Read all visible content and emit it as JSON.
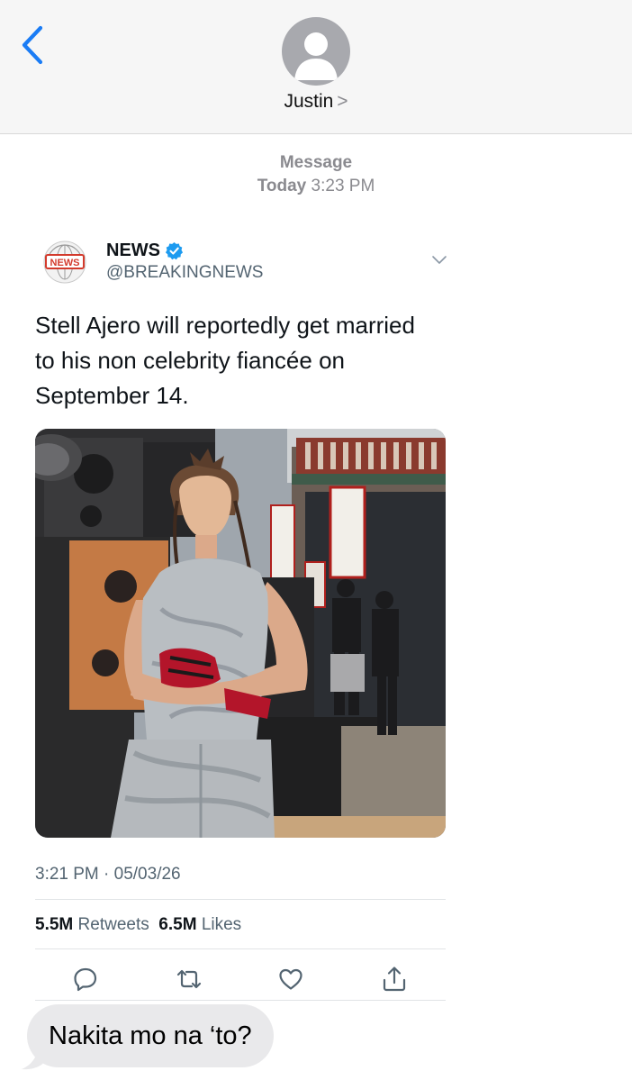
{
  "header": {
    "contact_name": "Justin",
    "contact_chevron": ">",
    "back_icon": "chevron-left-icon",
    "avatar_icon": "person-silhouette-icon",
    "accent_color": "#1a7cf5"
  },
  "conversation": {
    "service": "Message",
    "date_label": "Today",
    "time": "3:23 PM"
  },
  "tweet": {
    "logo_text": "NEWS",
    "name": "NEWS",
    "handle": "@BREAKINGNEWS",
    "verified_icon": "verified-badge-icon",
    "verified_color": "#1d9bf0",
    "text": "Stell Ajero will reportedly get married to his non celebrity fiancée on September 14.",
    "timestamp": "3:21 PM · 05/03/26",
    "retweets_count": "5.5M",
    "retweets_label": "Retweets",
    "likes_count": "6.5M",
    "likes_label": "Likes",
    "actions": [
      "reply-icon",
      "retweet-icon",
      "like-icon",
      "share-icon"
    ]
  },
  "message": {
    "text": "Nakita mo na ‘to?"
  }
}
